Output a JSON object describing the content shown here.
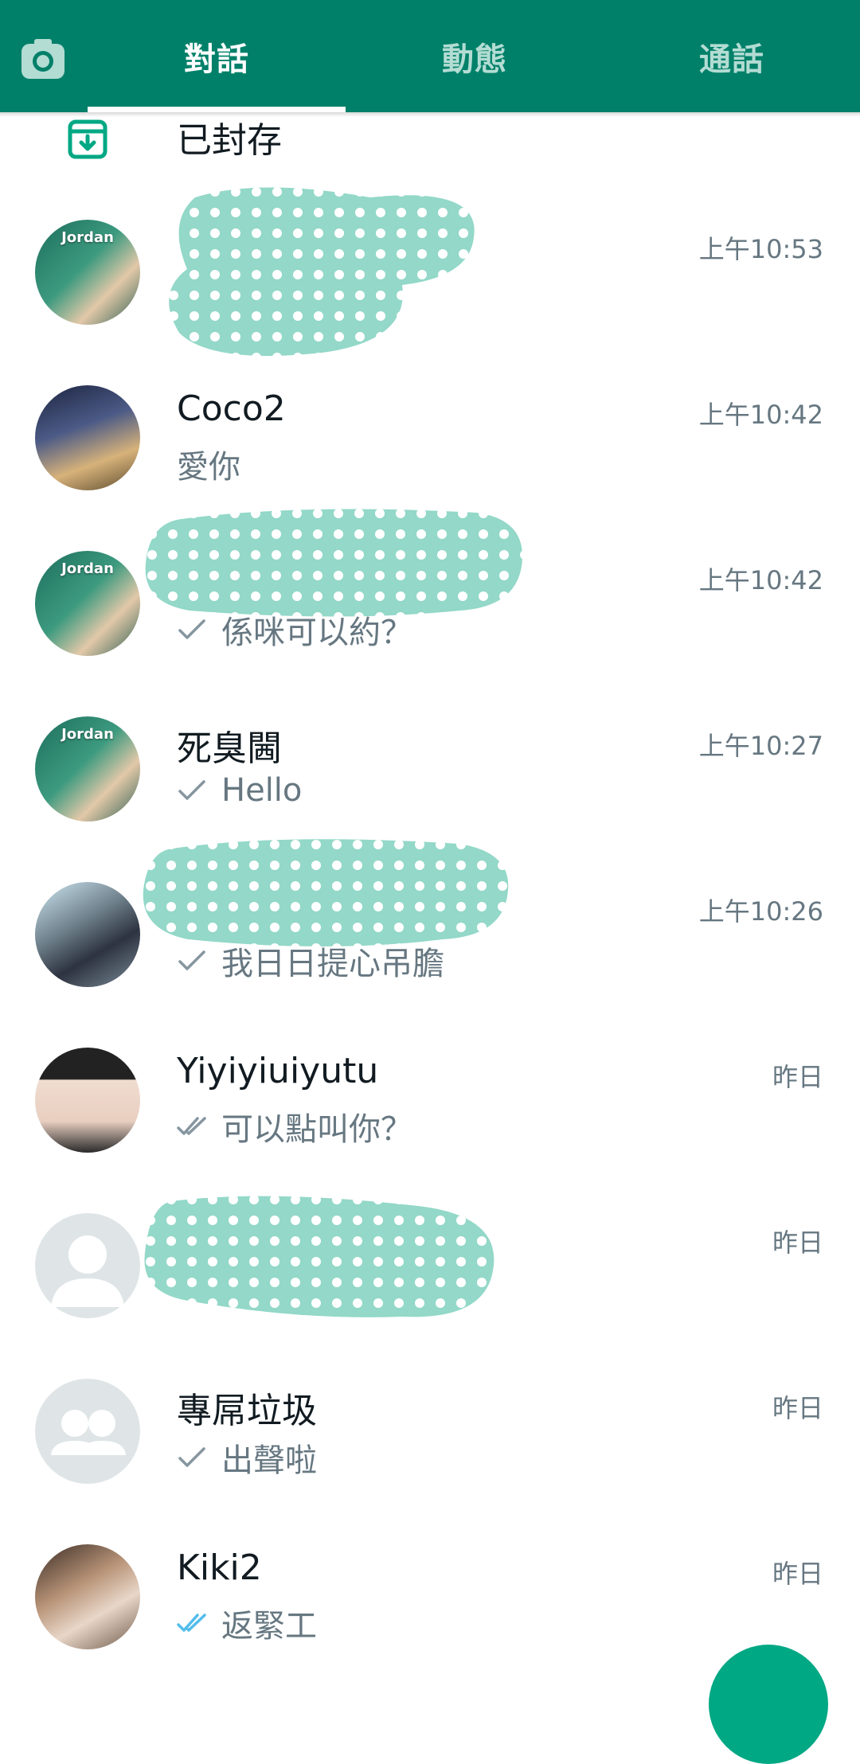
{
  "header": {
    "tabs": [
      {
        "label": "對話",
        "active": true
      },
      {
        "label": "動態",
        "active": false
      },
      {
        "label": "通話",
        "active": false
      }
    ],
    "camera_icon": "camera-icon"
  },
  "archived": {
    "label": "已封存",
    "icon": "archive-icon"
  },
  "chats": [
    {
      "name": "",
      "time": "上午10:53",
      "preview": "",
      "tick": "none",
      "avatar": "photo",
      "redacted": true
    },
    {
      "name": "Coco2",
      "time": "上午10:42",
      "preview": "愛你",
      "tick": "none",
      "avatar": "photo"
    },
    {
      "name": "",
      "time": "上午10:42",
      "preview": "係咪可以約？",
      "tick": "single",
      "avatar": "photo",
      "redacted": true
    },
    {
      "name": "死臭閪",
      "time": "上午10:27",
      "preview": "Hello",
      "tick": "single",
      "avatar": "photo"
    },
    {
      "name": "",
      "time": "上午10:26",
      "preview": "我日日提心吊膽",
      "tick": "single",
      "avatar": "photo",
      "redacted": true
    },
    {
      "name": "Yiyiyiuiyutu",
      "time": "昨日",
      "preview": "可以點叫你？",
      "tick": "double-grey",
      "avatar": "photo"
    },
    {
      "name": "",
      "time": "昨日",
      "preview": "",
      "tick": "double-grey",
      "avatar": "default-person",
      "redacted": true
    },
    {
      "name": "專屌垃圾",
      "time": "昨日",
      "preview": "出聲啦",
      "tick": "single",
      "avatar": "default-group"
    },
    {
      "name": "Kiki2",
      "time": "昨日",
      "preview": "返緊工",
      "tick": "double-blue",
      "avatar": "photo"
    }
  ],
  "avatar_text": "Jordan",
  "colors": {
    "header": "#008069",
    "tab_inactive": "#b3dcd3",
    "text_primary": "#111b21",
    "text_secondary": "#667781",
    "tick_blue": "#53bdeb",
    "redaction": "#93d8c8",
    "fab": "#00a884"
  }
}
